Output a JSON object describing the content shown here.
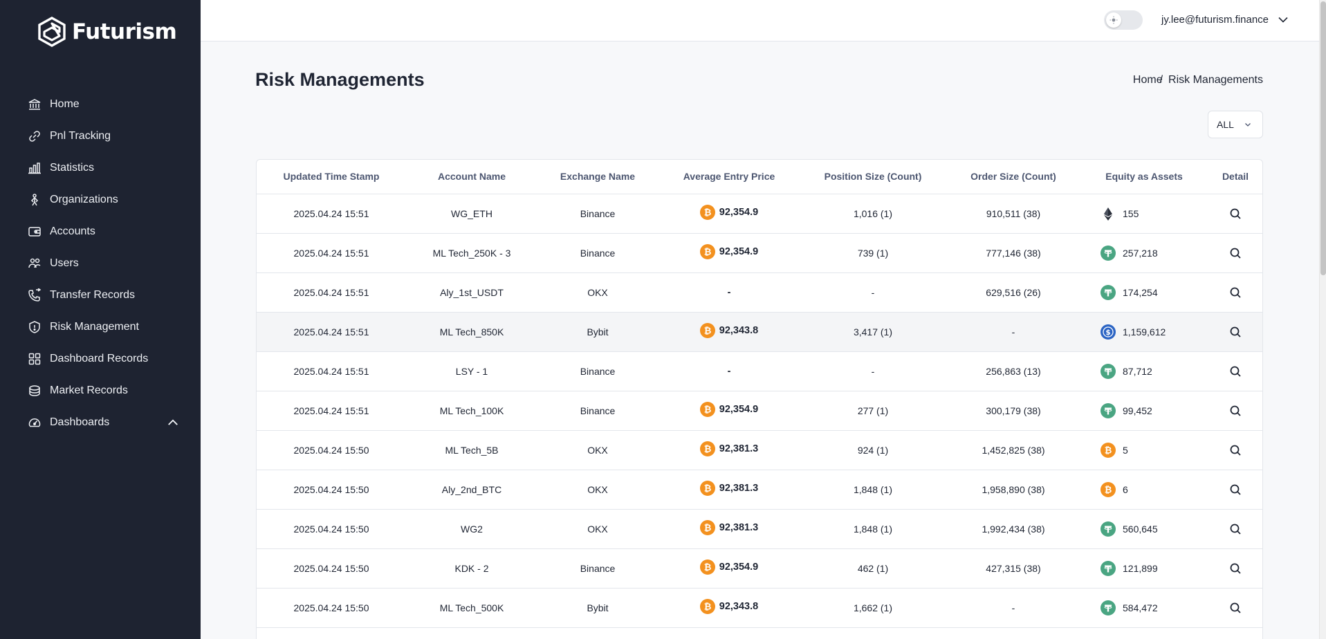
{
  "app": {
    "name": "Futurism"
  },
  "sidebar": {
    "items": [
      {
        "label": "Home",
        "icon": "bank-icon"
      },
      {
        "label": "Pnl Tracking",
        "icon": "link-icon"
      },
      {
        "label": "Statistics",
        "icon": "bar-chart-icon"
      },
      {
        "label": "Organizations",
        "icon": "organization-icon"
      },
      {
        "label": "Accounts",
        "icon": "wallet-icon"
      },
      {
        "label": "Users",
        "icon": "users-icon"
      },
      {
        "label": "Transfer Records",
        "icon": "phone-transfer-icon"
      },
      {
        "label": "Risk Management",
        "icon": "shield-icon"
      },
      {
        "label": "Dashboard Records",
        "icon": "grid-icon"
      },
      {
        "label": "Market Records",
        "icon": "coins-icon"
      },
      {
        "label": "Dashboards",
        "icon": "gauge-icon"
      }
    ]
  },
  "header": {
    "user_email": "jy.lee@futurism.finance"
  },
  "page": {
    "title": "Risk Managements",
    "breadcrumb": {
      "home": "Home",
      "separator": "/",
      "current": "Risk Managements"
    },
    "filter": {
      "selected": "ALL"
    }
  },
  "table": {
    "columns": [
      "Updated Time Stamp",
      "Account Name",
      "Exchange Name",
      "Average Entry Price",
      "Position Size (Count)",
      "Order Size (Count)",
      "Equity as Assets",
      "Detail"
    ],
    "rows": [
      {
        "time": "2025.04.24 15:51",
        "account": "WG_ETH",
        "exchange": "Binance",
        "price": "92,354.9",
        "price_coin": "btc",
        "position": "1,016 (1)",
        "order": "910,511 (38)",
        "equity": "155",
        "equity_coin": "eth"
      },
      {
        "time": "2025.04.24 15:51",
        "account": "ML Tech_250K - 3",
        "exchange": "Binance",
        "price": "92,354.9",
        "price_coin": "btc",
        "position": "739 (1)",
        "order": "777,146 (38)",
        "equity": "257,218",
        "equity_coin": "usdt"
      },
      {
        "time": "2025.04.24 15:51",
        "account": "Aly_1st_USDT",
        "exchange": "OKX",
        "price": "-",
        "price_coin": "",
        "position": "-",
        "order": "629,516 (26)",
        "equity": "174,254",
        "equity_coin": "usdt"
      },
      {
        "time": "2025.04.24 15:51",
        "account": "ML Tech_850K",
        "exchange": "Bybit",
        "price": "92,343.8",
        "price_coin": "btc",
        "position": "3,417 (1)",
        "order": "-",
        "equity": "1,159,612",
        "equity_coin": "usdc"
      },
      {
        "time": "2025.04.24 15:51",
        "account": "LSY - 1",
        "exchange": "Binance",
        "price": "-",
        "price_coin": "",
        "position": "-",
        "order": "256,863 (13)",
        "equity": "87,712",
        "equity_coin": "usdt"
      },
      {
        "time": "2025.04.24 15:51",
        "account": "ML Tech_100K",
        "exchange": "Binance",
        "price": "92,354.9",
        "price_coin": "btc",
        "position": "277 (1)",
        "order": "300,179 (38)",
        "equity": "99,452",
        "equity_coin": "usdt"
      },
      {
        "time": "2025.04.24 15:50",
        "account": "ML Tech_5B",
        "exchange": "OKX",
        "price": "92,381.3",
        "price_coin": "btc",
        "position": "924 (1)",
        "order": "1,452,825 (38)",
        "equity": "5",
        "equity_coin": "btc"
      },
      {
        "time": "2025.04.24 15:50",
        "account": "Aly_2nd_BTC",
        "exchange": "OKX",
        "price": "92,381.3",
        "price_coin": "btc",
        "position": "1,848 (1)",
        "order": "1,958,890 (38)",
        "equity": "6",
        "equity_coin": "btc"
      },
      {
        "time": "2025.04.24 15:50",
        "account": "WG2",
        "exchange": "OKX",
        "price": "92,381.3",
        "price_coin": "btc",
        "position": "1,848 (1)",
        "order": "1,992,434 (38)",
        "equity": "560,645",
        "equity_coin": "usdt"
      },
      {
        "time": "2025.04.24 15:50",
        "account": "KDK - 2",
        "exchange": "Binance",
        "price": "92,354.9",
        "price_coin": "btc",
        "position": "462 (1)",
        "order": "427,315 (38)",
        "equity": "121,899",
        "equity_coin": "usdt"
      },
      {
        "time": "2025.04.24 15:50",
        "account": "ML Tech_500K",
        "exchange": "Bybit",
        "price": "92,343.8",
        "price_coin": "btc",
        "position": "1,662 (1)",
        "order": "-",
        "equity": "584,472",
        "equity_coin": "usdt"
      },
      {
        "time": "",
        "account": "",
        "exchange": "",
        "price": "",
        "price_coin": "btc",
        "position": "",
        "order": "",
        "equity": "",
        "equity_coin": "usdt"
      }
    ],
    "highlighted_row": 3
  },
  "colors": {
    "sidebar_bg": "#1e2331",
    "btc": "#f3911f",
    "usdt": "#4aa582",
    "usdc": "#2b64c4"
  }
}
